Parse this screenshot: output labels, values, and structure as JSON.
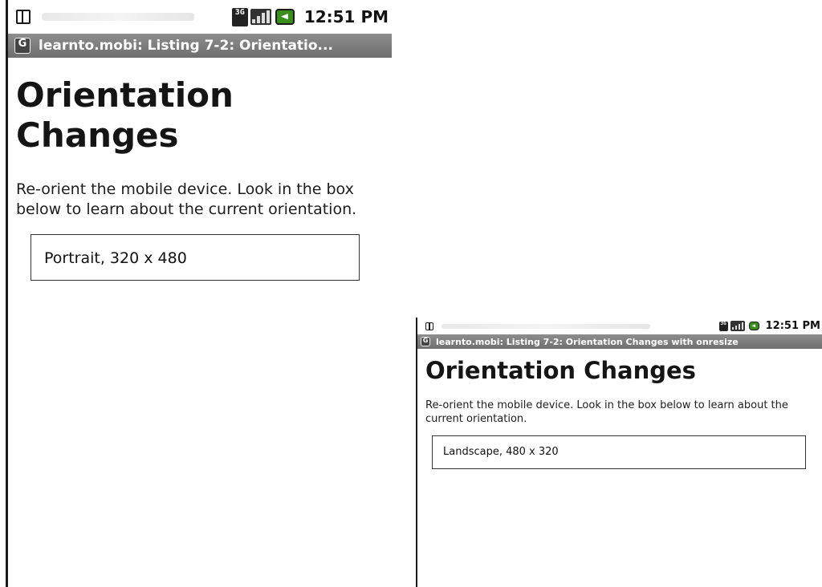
{
  "portrait": {
    "status": {
      "time": "12:51 PM",
      "network": "3G"
    },
    "title_bar": {
      "icon": "G",
      "text": "learnto.mobi: Listing 7-2: Orientatio..."
    },
    "heading": "Orientation Changes",
    "body": "Re-orient the mobile device. Look in the box below to learn about the current orientation.",
    "orientation_box": "Portrait, 320 x 480"
  },
  "landscape": {
    "status": {
      "time": "12:51 PM",
      "network": "3G"
    },
    "title_bar": {
      "icon": "G",
      "text": "learnto.mobi: Listing 7-2: Orientation Changes with onresize"
    },
    "heading": "Orientation Changes",
    "body": "Re-orient the mobile device. Look in the box below to learn about the current orientation.",
    "orientation_box": "Landscape, 480 x 320"
  },
  "colors": {
    "titlebar": "#7f7f7f",
    "battery": "#3a8e1c",
    "text": "#111111"
  },
  "icons": [
    "device-icon",
    "3g-icon",
    "signal-icon",
    "battery-icon",
    "browser-app-icon"
  ]
}
